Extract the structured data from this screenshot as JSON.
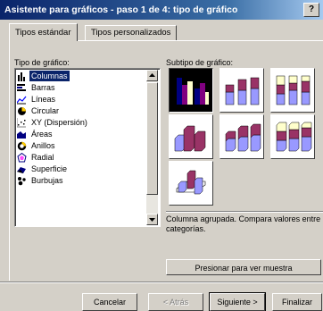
{
  "window": {
    "title": "Asistente para gráficos - paso 1 de 4: tipo de gráfico",
    "help_label": "?"
  },
  "tabs": [
    {
      "label": "Tipos estándar",
      "active": true
    },
    {
      "label": "Tipos personalizados",
      "active": false
    }
  ],
  "chart_type": {
    "label": "Tipo de gráfico:",
    "items": [
      {
        "label": "Columnas",
        "icon": "column-chart-icon",
        "selected": true
      },
      {
        "label": "Barras",
        "icon": "bar-chart-icon"
      },
      {
        "label": "Líneas",
        "icon": "line-chart-icon"
      },
      {
        "label": "Circular",
        "icon": "pie-chart-icon"
      },
      {
        "label": "XY (Dispersión)",
        "icon": "scatter-chart-icon"
      },
      {
        "label": "Áreas",
        "icon": "area-chart-icon"
      },
      {
        "label": "Anillos",
        "icon": "doughnut-chart-icon"
      },
      {
        "label": "Radial",
        "icon": "radar-chart-icon"
      },
      {
        "label": "Superficie",
        "icon": "surface-chart-icon"
      },
      {
        "label": "Burbujas",
        "icon": "bubble-chart-icon"
      }
    ]
  },
  "subtype": {
    "label": "Subtipo de gráfico:",
    "selected_index": 0
  },
  "description": "Columna agrupada. Compara valores entre categorías.",
  "buttons": {
    "preview": "Presionar para ver muestra",
    "cancel": "Cancelar",
    "back": "< Atrás",
    "next": "Siguiente >",
    "finish": "Finalizar"
  },
  "colors": {
    "title_start": "#0a246a",
    "face": "#d4d0c8",
    "series1": "#9999ff",
    "series2": "#993366",
    "series3": "#ffffcc",
    "selection": "#0a246a"
  }
}
